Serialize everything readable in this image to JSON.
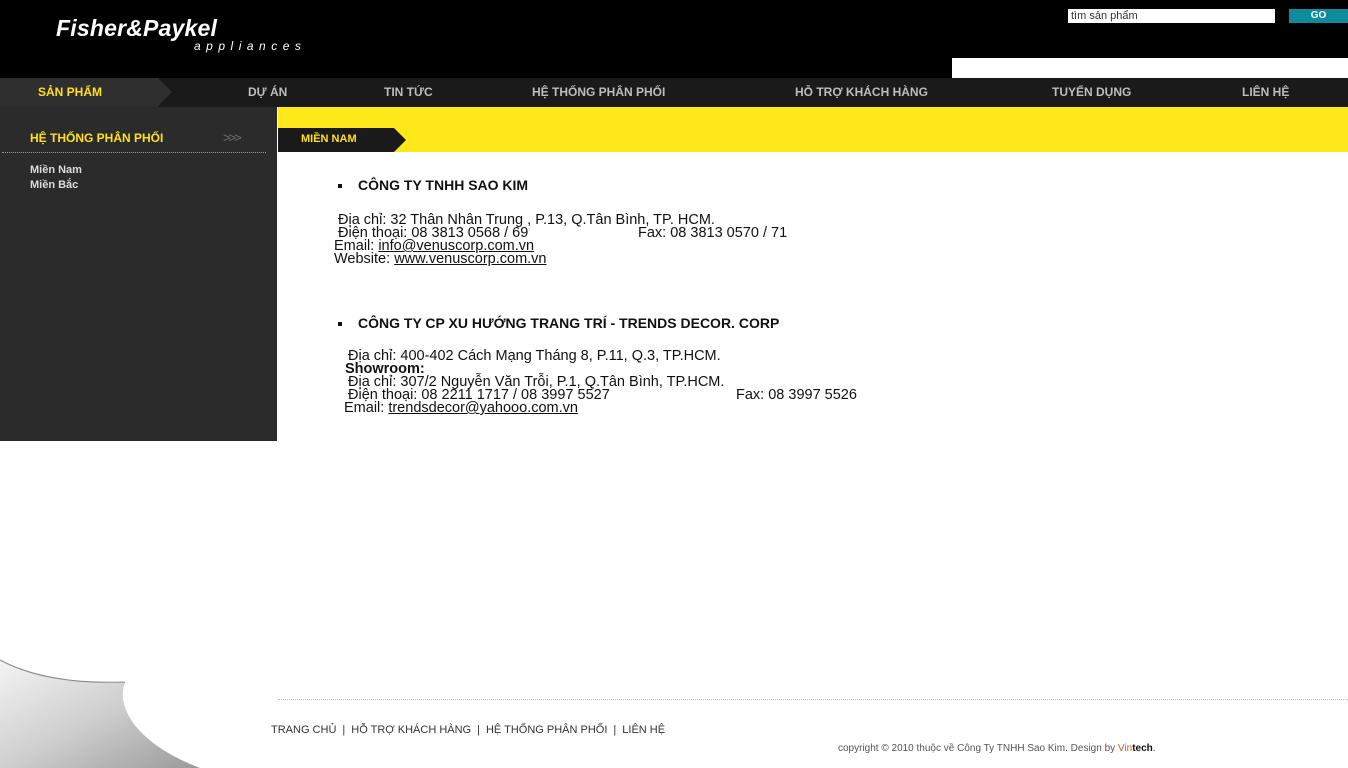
{
  "header": {
    "logo_main": "Fisher&Paykel",
    "logo_sub": "appliances",
    "search_placeholder": "tìm sản phẩm",
    "go_label": "GO"
  },
  "nav": {
    "items": [
      {
        "label": "SẢN PHẨM",
        "active": true
      },
      {
        "label": "DỰ ÁN"
      },
      {
        "label": "TIN TỨC"
      },
      {
        "label": "HỆ THỐNG PHÂN PHỐI"
      },
      {
        "label": "HỖ TRỢ KHÁCH HÀNG"
      },
      {
        "label": "TUYỂN DỤNG"
      },
      {
        "label": "LIÊN HỆ"
      }
    ]
  },
  "sidebar": {
    "title": "HỆ THỐNG PHÂN PHỐI",
    "chevrons": ">>>",
    "links": [
      "Miền Nam",
      "Miền Bắc"
    ]
  },
  "content": {
    "region_tab": "MIỀN NAM",
    "companies": [
      {
        "name": "CÔNG TY TNHH SAO KIM",
        "address": "Địa chỉ: 32 Thân Nhân Trung , P.13, Q.Tân Bình, TP. HCM.",
        "phone": "Điện thoại: 08 3813 0568 / 69",
        "fax": "Fax: 08 3813 0570 / 71",
        "email_label": "Email: ",
        "email": "info@venuscorp.com.vn",
        "website_label": "Website: ",
        "website": "www.venuscorp.com.vn"
      },
      {
        "name": "CÔNG TY CP XU HƯỚNG TRANG TRÍ - TRENDS DECOR. CORP",
        "address": "Địa chỉ: 400-402 Cách Mạng Tháng 8, P.11, Q.3, TP.HCM.",
        "showroom_label": "Showroom:",
        "showroom_address": "Địa chỉ: 307/2 Nguyễn Văn Trỗi, P.1, Q.Tân Bình, TP.HCM.",
        "phone": "Điện thoại: 08 2211 1717 / 08 3997 5527",
        "fax": "Fax: 08 3997 5526",
        "email_label": "Email: ",
        "email": "trendsdecor@yahooo.com.vn"
      }
    ]
  },
  "footer": {
    "links": [
      "TRANG CHỦ",
      "HỖ TRỢ KHÁCH HÀNG",
      "HỆ THỐNG PHÂN PHỐI",
      "LIÊN HỆ"
    ],
    "separator": "|",
    "copyright": "copyright © 2010 thuộc về Công Ty TNHH Sao Kim. Design by ",
    "design_vin": "Vin",
    "design_tech": "tech",
    "design_dot": "."
  },
  "colors": {
    "accent_yellow": "#ffe81a",
    "header_black": "#000000",
    "sidebar_gray": "#2b2b2b",
    "go_teal": "#0f8b9e",
    "vin_orange": "#e85a12"
  }
}
